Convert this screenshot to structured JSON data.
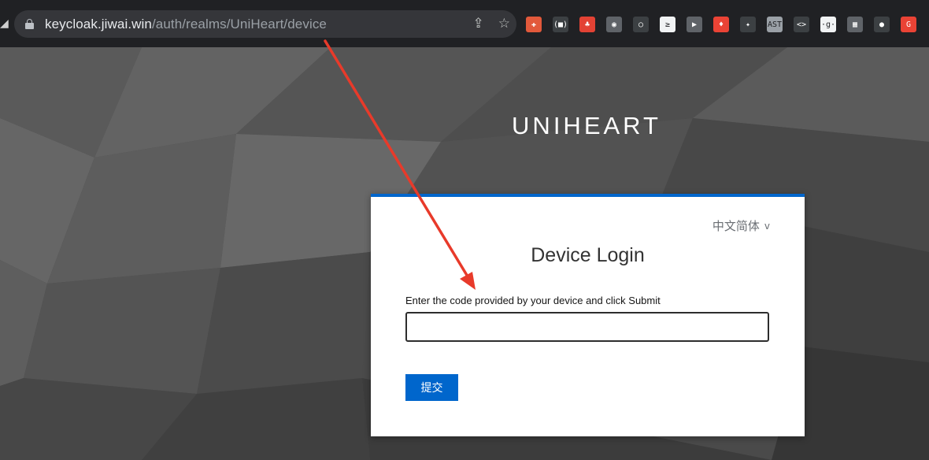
{
  "browser": {
    "url_host": "keycloak.jiwai.win",
    "url_path": "/auth/realms/UniHeart/device",
    "omnibox_icons": [
      "share-icon",
      "star-icon"
    ],
    "extensions": [
      {
        "name": "fox-extension-icon",
        "glyph": "✚",
        "color": "#e2593b"
      },
      {
        "name": "braces-extension-icon",
        "glyph": "(■)",
        "color": "#3c4043"
      },
      {
        "name": "tree-extension-icon",
        "glyph": "♣",
        "color": "#e34234"
      },
      {
        "name": "camera-extension-icon",
        "glyph": "◉",
        "color": "#5f6368"
      },
      {
        "name": "circle-extension-icon",
        "glyph": "○",
        "color": "#3c4043"
      },
      {
        "name": "terminal-extension-icon",
        "glyph": "≥",
        "color": "#f1f3f4"
      },
      {
        "name": "play-extension-icon",
        "glyph": "▶",
        "color": "#5f6368"
      },
      {
        "name": "flame-extension-icon",
        "glyph": "♦",
        "color": "#ea4335"
      },
      {
        "name": "gear-extension-icon",
        "glyph": "✦",
        "color": "#3c4043"
      },
      {
        "name": "ast-extension-icon",
        "glyph": "AST",
        "color": "#9aa0a6"
      },
      {
        "name": "code-extension-icon",
        "glyph": "<>",
        "color": "#3c4043"
      },
      {
        "name": "g-extension-icon",
        "glyph": "·g·",
        "color": "#f1f3f4"
      },
      {
        "name": "grid-extension-icon",
        "glyph": "▦",
        "color": "#5f6368"
      },
      {
        "name": "github-extension-icon",
        "glyph": "●",
        "color": "#3c4043"
      },
      {
        "name": "red-extension-icon",
        "glyph": "G",
        "color": "#ea4335"
      }
    ]
  },
  "page": {
    "brand": "UNIHEART",
    "language": "中文简体",
    "language_caret": "v",
    "title": "Device Login",
    "code_label": "Enter the code provided by your device and click Submit",
    "code_value": "",
    "submit_label": "提交"
  },
  "colors": {
    "accent": "#0066cc",
    "annotation_arrow": "#e83a2a"
  }
}
